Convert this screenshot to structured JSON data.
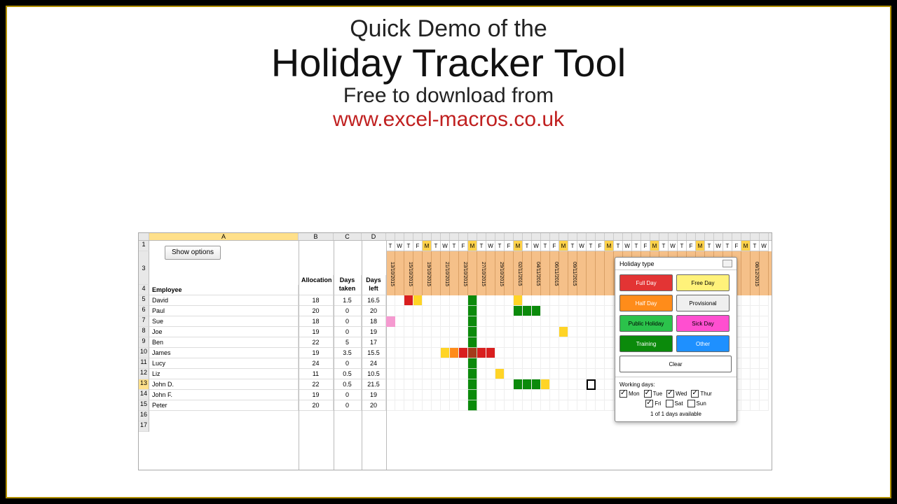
{
  "title": {
    "line1": "Quick Demo of the",
    "line2": "Holiday Tracker Tool",
    "line3": "Free to download from",
    "url": "www.excel-macros.co.uk"
  },
  "columns": {
    "A": "A",
    "B": "B",
    "C": "C",
    "D": "D"
  },
  "buttons": {
    "show_options": "Show options"
  },
  "headers": {
    "employee": "Employee",
    "allocation": "Allocation",
    "days_taken": "Days taken",
    "days_left": "Days left"
  },
  "rows": [
    {
      "n": "5",
      "name": "David",
      "alloc": "18",
      "taken": "1.5",
      "left": "16.5"
    },
    {
      "n": "6",
      "name": "Paul",
      "alloc": "20",
      "taken": "0",
      "left": "20"
    },
    {
      "n": "7",
      "name": "Sue",
      "alloc": "18",
      "taken": "0",
      "left": "18"
    },
    {
      "n": "8",
      "name": "Joe",
      "alloc": "19",
      "taken": "0",
      "left": "19"
    },
    {
      "n": "9",
      "name": "Ben",
      "alloc": "22",
      "taken": "5",
      "left": "17"
    },
    {
      "n": "10",
      "name": "James",
      "alloc": "19",
      "taken": "3.5",
      "left": "15.5"
    },
    {
      "n": "11",
      "name": "Lucy",
      "alloc": "24",
      "taken": "0",
      "left": "24"
    },
    {
      "n": "12",
      "name": "Liz",
      "alloc": "11",
      "taken": "0.5",
      "left": "10.5"
    },
    {
      "n": "13",
      "name": "John D.",
      "alloc": "22",
      "taken": "0.5",
      "left": "21.5"
    },
    {
      "n": "14",
      "name": "John F.",
      "alloc": "19",
      "taken": "0",
      "left": "19"
    },
    {
      "n": "15",
      "name": "Peter",
      "alloc": "20",
      "taken": "0",
      "left": "20"
    }
  ],
  "extra_rows": [
    "16",
    "17"
  ],
  "row_labels": {
    "r1": "1",
    "r3": "3",
    "r4": "4"
  },
  "day_letters": [
    "T",
    "W",
    "T",
    "F",
    "M",
    "T",
    "W",
    "T",
    "F",
    "M",
    "T",
    "W",
    "T",
    "F",
    "M",
    "T",
    "W",
    "T",
    "F",
    "M",
    "T",
    "W",
    "T",
    "F",
    "M",
    "T",
    "W",
    "T",
    "F",
    "M",
    "T",
    "W",
    "T",
    "F",
    "M",
    "T",
    "W",
    "T",
    "F",
    "M",
    "T",
    "W"
  ],
  "date_labels": [
    "13/10/2015",
    "",
    "15/10/2015",
    "",
    "19/10/2015",
    "",
    "21/10/2015",
    "",
    "23/10/2015",
    "",
    "27/10/2015",
    "",
    "29/10/2015",
    "",
    "02/11/2015",
    "",
    "04/11/2015",
    "",
    "06/11/2015",
    "",
    "09/11/2015",
    "",
    "",
    "",
    "",
    "",
    "",
    "",
    "",
    "",
    "",
    "",
    "",
    "",
    "",
    "",
    "",
    "",
    "",
    "",
    "08/12/2015",
    ""
  ],
  "popup": {
    "title": "Holiday type",
    "buttons": {
      "full_day": "Full Day",
      "free_day": "Free Day",
      "half_day": "Half Day",
      "provisional": "Provisional",
      "public_holiday": "Public Holiday",
      "sick_day": "Sick Day",
      "training": "Training",
      "other": "Other",
      "clear": "Clear"
    },
    "working_days_label": "Working days:",
    "days": {
      "mon": "Mon",
      "tue": "Tue",
      "wed": "Wed",
      "thur": "Thur",
      "fri": "Fri",
      "sat": "Sat",
      "sun": "Sun"
    },
    "checked": {
      "mon": true,
      "tue": true,
      "wed": true,
      "thur": true,
      "fri": true,
      "sat": false,
      "sun": false
    },
    "available": "1 of 1 days available"
  }
}
